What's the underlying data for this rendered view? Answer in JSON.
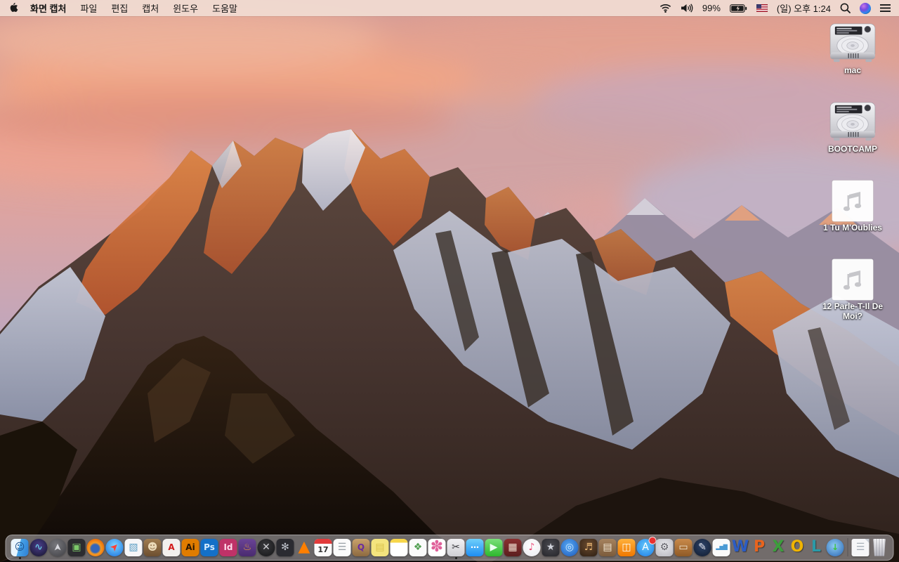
{
  "menu_bar": {
    "menus": [
      "화면 캡처",
      "파일",
      "편집",
      "캡처",
      "윈도우",
      "도움말"
    ],
    "status": {
      "battery_percent": "99%",
      "clock": "(일) 오후 1:24"
    }
  },
  "desktop_icons": [
    {
      "label": "mac",
      "kind": "hard-drive"
    },
    {
      "label": "BOOTCAMP",
      "kind": "hard-drive"
    },
    {
      "label": "1 Tu M'Oublies",
      "kind": "audio-file"
    },
    {
      "label": "12 Parle-T-Il De Moi?",
      "kind": "audio-file"
    }
  ],
  "dock": {
    "items": [
      {
        "name": "finder",
        "glyph": "☺",
        "fg": "#1b4f8a",
        "bg": "linear-gradient(105deg,#eaf5fd 0%,#eaf5fd 46%,#49a5e8 46%,#2e7fd4 100%)",
        "shape": "square",
        "running": true
      },
      {
        "name": "siri",
        "glyph": "∿",
        "fg": "#6ee0f0",
        "bg": "radial-gradient(circle at 50% 40%,#4a3f8c,#151329)",
        "shape": "circle"
      },
      {
        "name": "launchpad",
        "glyph": "➤",
        "fg": "#d8d8de",
        "bg": "radial-gradient(circle at 40% 35%,#77777c,#3f3f44)",
        "shape": "circle",
        "cls": "rotup"
      },
      {
        "name": "mission-control",
        "glyph": "▣",
        "fg": "#7cc96a",
        "bg": "#2c2c30",
        "shape": "square"
      },
      {
        "name": "firefox",
        "glyph": "",
        "fg": "#fff",
        "bg": "radial-gradient(circle at 48% 55%,#3566b8 0%,#3566b8 30%,#f59a23 44%,#e66000 80%)",
        "shape": "circle"
      },
      {
        "name": "safari",
        "glyph": "➤",
        "fg": "#ff4136",
        "bg": "radial-gradient(circle at 50% 38%,#7fd4ff,#1670e0)",
        "shape": "circle",
        "cls": "rotne"
      },
      {
        "name": "preview",
        "glyph": "▧",
        "fg": "#5c9ec4",
        "bg": "#f6f6f8",
        "shape": "square"
      },
      {
        "name": "contacts",
        "glyph": "☻",
        "fg": "#ead9b8",
        "bg": "linear-gradient(#a07c50,#6d4f30)",
        "shape": "square"
      },
      {
        "name": "adobe-acrobat-reader",
        "glyph": "A",
        "fg": "#d21a1a",
        "bg": "#f2f0ee",
        "shape": "square",
        "cls": "bold"
      },
      {
        "name": "adobe-illustrator",
        "glyph": "Ai",
        "fg": "#2a1600",
        "bg": "#e07c00",
        "shape": "square",
        "cls": "bold"
      },
      {
        "name": "adobe-photoshop",
        "glyph": "Ps",
        "fg": "#d6ecff",
        "bg": "#1470c8",
        "shape": "square",
        "cls": "bold"
      },
      {
        "name": "adobe-indesign",
        "glyph": "Id",
        "fg": "#ffd9ea",
        "bg": "#bf3268",
        "shape": "square",
        "cls": "bold"
      },
      {
        "name": "toast-titanium",
        "glyph": "♨",
        "fg": "#e8a040",
        "bg": "linear-gradient(#6a4496,#4a2b70)",
        "shape": "square"
      },
      {
        "name": "xee-image-viewer",
        "glyph": "✕",
        "fg": "#cfcfd4",
        "bg": "radial-gradient(circle at 45% 40%,#3a3a3e,#141416)",
        "shape": "circle"
      },
      {
        "name": "disk-fan-utility",
        "glyph": "✻",
        "fg": "#bfc3cc",
        "bg": "#2b2b31",
        "shape": "square"
      },
      {
        "name": "vlc",
        "glyph": "▲",
        "fg": "#ff7f00",
        "shape": "none",
        "cls": "big"
      },
      {
        "name": "calendar",
        "glyph": "17",
        "fg": "#333333",
        "bg": "#fbfbfb",
        "shape": "square",
        "cls": "calendar"
      },
      {
        "name": "reminders",
        "glyph": "☰",
        "fg": "#9aa0a6",
        "bg": "#fbfbfb",
        "shape": "square"
      },
      {
        "name": "quark-inbox",
        "glyph": "Q",
        "fg": "#6a2ba0",
        "bg": "linear-gradient(#c9a26c,#8d6a40)",
        "shape": "square",
        "cls": "bold"
      },
      {
        "name": "stickies",
        "glyph": "▤",
        "fg": "#d9c24a",
        "bg": "#f4e47e",
        "shape": "square"
      },
      {
        "name": "notes",
        "glyph": "",
        "fg": "#fff",
        "bg": "linear-gradient(#f7d64a 0 22%,#ffffff 22%)",
        "shape": "square"
      },
      {
        "name": "document-stack",
        "glyph": "❖",
        "fg": "#4f9e4f",
        "bg": "#fafafa",
        "shape": "square"
      },
      {
        "name": "photos",
        "glyph": "✽",
        "fg": "#e0609a",
        "bg": "#ffffff",
        "shape": "square",
        "cls": "big"
      },
      {
        "name": "screen-capture-grab",
        "glyph": "✂",
        "fg": "#3a3a3e",
        "bg": "linear-gradient(#f2f2f4,#cfcfd4)",
        "shape": "square",
        "running": true
      },
      {
        "name": "messages",
        "glyph": "⋯",
        "fg": "#ffffff",
        "bg": "linear-gradient(#6fd0fb,#1e8df2)",
        "shape": "square",
        "cls": "bold"
      },
      {
        "name": "facetime",
        "glyph": "▶",
        "fg": "#eafff0",
        "bg": "linear-gradient(#7ae07a,#2db82d)",
        "shape": "square"
      },
      {
        "name": "photo-booth",
        "glyph": "▦",
        "fg": "#f2e3d4",
        "bg": "linear-gradient(#8a3030,#5c1f1f)",
        "shape": "square"
      },
      {
        "name": "itunes",
        "glyph": "♪",
        "fg": "#e84a78",
        "bg": "radial-gradient(circle at 50% 40%,#ffffff,#e9e9ee)",
        "shape": "circle"
      },
      {
        "name": "imovie",
        "glyph": "★",
        "fg": "#cfd2da",
        "bg": "radial-gradient(circle at 50% 40%,#4a4a50,#26262b)",
        "shape": "square"
      },
      {
        "name": "dvd-studio",
        "glyph": "◎",
        "fg": "#cfe8ff",
        "bg": "radial-gradient(circle at 45% 40%,#58aaf4,#1a56b8)",
        "shape": "circle"
      },
      {
        "name": "garageband",
        "glyph": "♬",
        "fg": "#e0b070",
        "bg": "radial-gradient(circle at 50% 35%,#6a4a2e,#2f2014)",
        "shape": "square"
      },
      {
        "name": "scrapbook-kit",
        "glyph": "▤",
        "fg": "#f4e8d4",
        "bg": "linear-gradient(#a5825e,#7c5c3c)",
        "shape": "square"
      },
      {
        "name": "ibooks",
        "glyph": "◫",
        "fg": "#ffffff",
        "bg": "linear-gradient(#ffb13b,#f07800)",
        "shape": "square"
      },
      {
        "name": "app-store",
        "glyph": "A",
        "fg": "#ffffff",
        "bg": "radial-gradient(circle at 50% 40%,#64c8fa,#1c7ce8)",
        "shape": "circle",
        "badge": true
      },
      {
        "name": "system-preferences",
        "glyph": "⚙",
        "fg": "#5f5f66",
        "bg": "radial-gradient(circle at 50% 40%,#e8e8ec,#b9b9c0)",
        "shape": "square"
      },
      {
        "name": "keynote",
        "glyph": "▭",
        "fg": "#f4ecd8",
        "bg": "linear-gradient(#c98a4a,#8f5a26)",
        "shape": "square"
      },
      {
        "name": "pages",
        "glyph": "✎",
        "fg": "#e8e8f0",
        "bg": "radial-gradient(circle at 50% 40%,#2e4469,#101a2e)",
        "shape": "circle"
      },
      {
        "name": "numbers",
        "glyph": "▂▅▇",
        "fg": "#4a9ad4",
        "bg": "#fafafa",
        "shape": "square",
        "cls": "tiny"
      },
      {
        "name": "word",
        "glyph": "W",
        "fg": "#2b5cc4",
        "shape": "none",
        "cls": "office"
      },
      {
        "name": "powerpoint",
        "glyph": "P",
        "fg": "#e8641e",
        "shape": "none",
        "cls": "office"
      },
      {
        "name": "excel",
        "glyph": "X",
        "fg": "#3c9e3c",
        "shape": "none",
        "cls": "office"
      },
      {
        "name": "outlook",
        "glyph": "O",
        "fg": "#f0b400",
        "shape": "none",
        "cls": "office"
      },
      {
        "name": "lync",
        "glyph": "L",
        "fg": "#2a9aa8",
        "shape": "none",
        "cls": "office"
      },
      {
        "name": "web-downloader",
        "glyph": "↓",
        "fg": "#3ec43e",
        "bg": "radial-gradient(circle at 45% 40%,#8ecdf2,#2a64b4)",
        "shape": "circle",
        "cls": "bold"
      },
      {
        "name": "dock-divider",
        "divider": true
      },
      {
        "name": "document-file",
        "glyph": "☰",
        "fg": "#a8b0b8",
        "bg": "#f6f6f8",
        "shape": "square",
        "cls": "file"
      },
      {
        "name": "trash",
        "glyph": "",
        "fg": "#888",
        "bg": "linear-gradient(#f6f6f8,#b2b2bc)",
        "shape": "square",
        "cls": "trash"
      }
    ]
  },
  "colors": {
    "menu_bar_bg": "#f0dbd1",
    "dock_bg": "rgba(206,204,212,0.48)",
    "sunlit_orange": "#cf6a38",
    "sky_salmon": "#e7a691",
    "sky_lavender": "#b5a6c0"
  }
}
